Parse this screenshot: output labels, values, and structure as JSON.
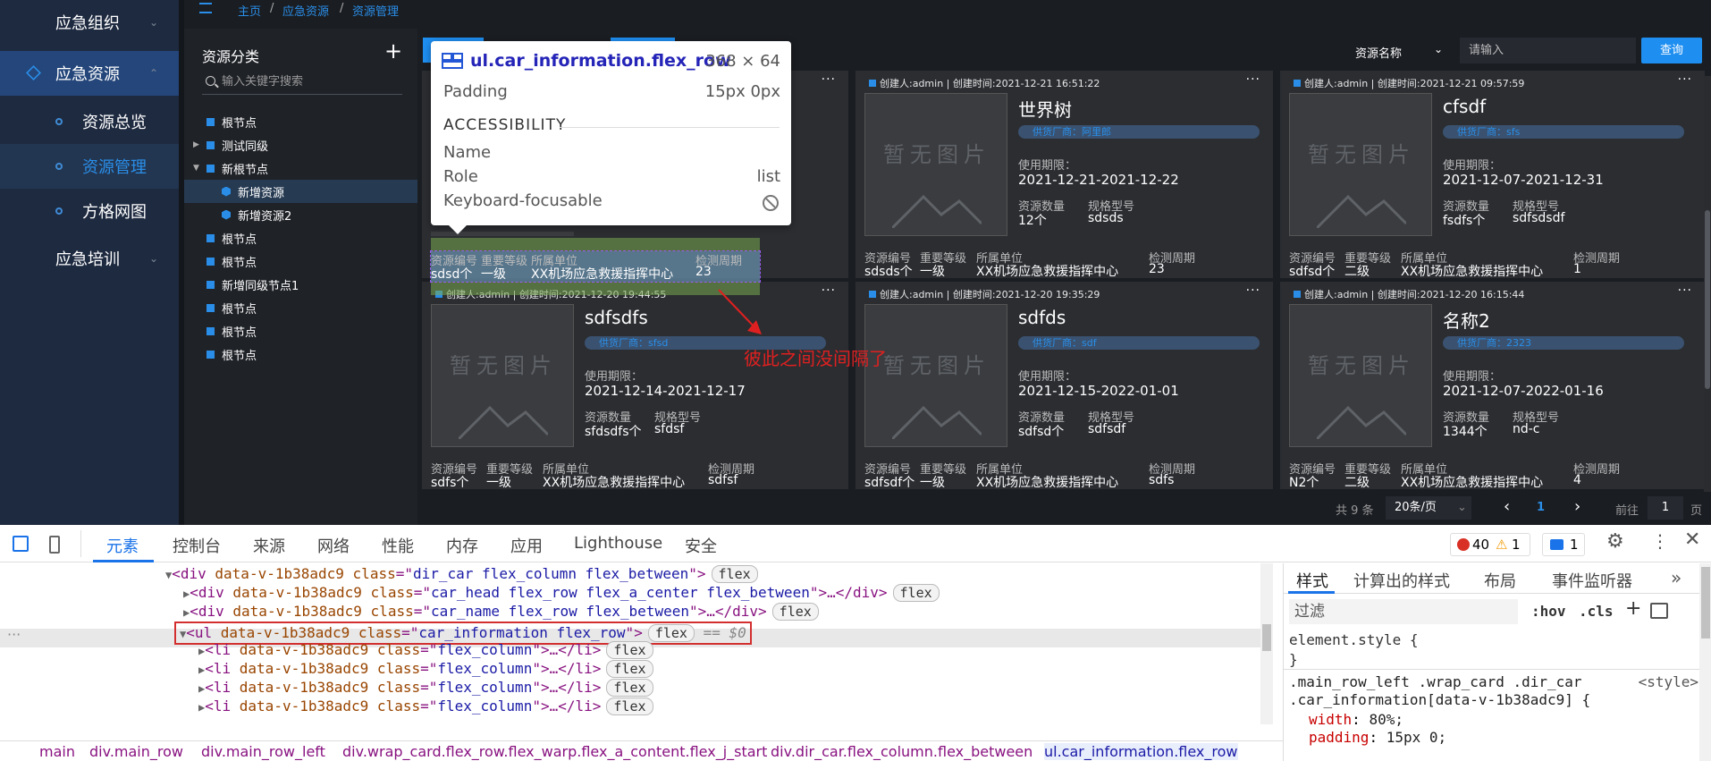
{
  "nav": {
    "items": [
      {
        "label": "应急组织",
        "chev": "⌄"
      },
      {
        "label": "应急资源",
        "chev": "⌃"
      },
      {
        "label": "资源总览"
      },
      {
        "label": "资源管理"
      },
      {
        "label": "方格网图"
      },
      {
        "label": "应急培训",
        "chev": "⌄"
      }
    ]
  },
  "breadcrumb": {
    "home": "主页",
    "sep": "/",
    "l1": "应急资源",
    "l2": "资源管理"
  },
  "tree": {
    "title": "资源分类",
    "add": "+",
    "search_placeholder": "输入关键字搜索",
    "nodes": [
      "根节点",
      "测试同级",
      "新根节点",
      "新增资源",
      "新增资源2",
      "根节点",
      "根节点",
      "新增同级节点1",
      "根节点",
      "根节点",
      "根节点"
    ]
  },
  "search": {
    "field_label": "资源名称",
    "placeholder": "请输入",
    "button": "查询"
  },
  "card_labels": {
    "vendor_prefix": "供货厂商：",
    "period": "使用期限：",
    "qty": "资源数量",
    "model": "规格型号",
    "code": "资源编号",
    "level": "重要等级",
    "unit": "所属单位",
    "cycle": "检测周期",
    "nopic": "暂无图片",
    "more": "···"
  },
  "cards": [
    {
      "header": "创建人:admin | 创建时间:2021-12-21 16:51:22",
      "name": "世界树",
      "vendor": "阿里郎",
      "date": "2021-12-21-2021-12-22",
      "qty": "12个",
      "model": "sdsds",
      "code": "sdsds个",
      "level": "一级",
      "unit": "XX机场应急救援指挥中心",
      "cycle": "23"
    },
    {
      "header": "创建人:admin | 创建时间:2021-12-21 09:57:59",
      "name": "cfsdf",
      "vendor": "sfs",
      "date": "2021-12-07-2021-12-31",
      "qty": "fsdfs个",
      "model": "sdfsdsdf",
      "code": "sdfsd个",
      "level": "二级",
      "unit": "XX机场应急救援指挥中心",
      "cycle": "1"
    },
    {
      "header": "创建人:admin | 创建时间:2021-12-20 19:44:55",
      "name": "sdfsdfs",
      "vendor": "sfsd",
      "date": "2021-12-14-2021-12-17",
      "qty": "sfdsdfs个",
      "model": "sfdsf",
      "code": "sdfs个",
      "level": "一级",
      "unit": "XX机场应急救援指挥中心",
      "cycle": "sdfsf"
    },
    {
      "header": "创建人:admin | 创建时间:2021-12-20 19:35:29",
      "name": "sdfds",
      "vendor": "sdf",
      "date": "2021-12-15-2022-01-01",
      "qty": "sdfsd个",
      "model": "sdfsdf",
      "code": "sdfsdf个",
      "level": "一级",
      "unit": "XX机场应急救援指挥中心",
      "cycle": "sdfs"
    },
    {
      "header": "创建人:admin | 创建时间:2021-12-20 16:15:44",
      "name": "名称2",
      "vendor": "2323",
      "date": "2021-12-07-2022-01-16",
      "qty": "1344个",
      "model": "nd-c",
      "code": "N2个",
      "level": "二级",
      "unit": "XX机场应急救援指挥中心",
      "cycle": "4"
    }
  ],
  "first_card_info": {
    "code": "sdsd个",
    "level": "一级",
    "unit": "XX机场应急救援指挥中心",
    "cycle": "23"
  },
  "pager": {
    "total": "共 9 条",
    "per_page": "20条/页",
    "prev": "‹",
    "page": "1",
    "next": "›",
    "goto": "前往",
    "goto_value": "1",
    "goto_suffix": "页"
  },
  "tooltip": {
    "selector": "ul.car_information.flex_row",
    "size": "368 × 64",
    "padding_label": "Padding",
    "padding_value": "15px 0px",
    "section": "ACCESSIBILITY",
    "name_label": "Name",
    "role_label": "Role",
    "role_value": "list",
    "focus_label": "Keyboard-focusable"
  },
  "annotation": "彼此之间没间隔了",
  "devtools": {
    "tabs": [
      "元素",
      "控制台",
      "来源",
      "网络",
      "性能",
      "内存",
      "应用",
      "Lighthouse",
      "安全"
    ],
    "errors": "40",
    "warnings": "1",
    "messages": "1",
    "code": [
      {
        "tag": "<div",
        "attr": "data-v-1b38adc9",
        "cls": "dir_car flex_column flex_between",
        "end": ">",
        "pill": "flex"
      },
      {
        "tag": "<div",
        "attr": "data-v-1b38adc9",
        "cls": "car_head flex_row flex_a_center flex_between",
        "end": ">…</div>",
        "pill": "flex"
      },
      {
        "tag": "<div",
        "attr": "data-v-1b38adc9",
        "cls": "car_name flex_row flex_between",
        "end": ">…</div>",
        "pill": "flex"
      },
      {
        "tag": "<ul",
        "attr": "data-v-1b38adc9",
        "cls": "car_information flex_row",
        "end": ">",
        "pill": "flex",
        "eq": "== $0"
      },
      {
        "tag": "<li",
        "attr": "data-v-1b38adc9",
        "cls": "flex_column",
        "end": ">…</li>",
        "pill": "flex"
      },
      {
        "tag": "<li",
        "attr": "data-v-1b38adc9",
        "cls": "flex_column",
        "end": ">…</li>",
        "pill": "flex"
      },
      {
        "tag": "<li",
        "attr": "data-v-1b38adc9",
        "cls": "flex_column",
        "end": ">…</li>",
        "pill": "flex"
      },
      {
        "tag": "<li",
        "attr": "data-v-1b38adc9",
        "cls": "flex_column",
        "end": ">…</li>",
        "pill": "flex"
      }
    ],
    "styles_tabs": [
      "样式",
      "计算出的样式",
      "布局",
      "事件监听器"
    ],
    "filter": "过滤",
    "hov": ":hov",
    "cls": ".cls",
    "element_style": "element.style {",
    "close_brace": "}",
    "rule_selector1": ".main_row_left .wrap_card .dir_car",
    "rule_selector2": ".car_information[data-v-1b38adc9] {",
    "rule_source": "<style>",
    "prop_width": "width",
    "prop_width_val": "80%;",
    "prop_padding": "padding",
    "prop_padding_val": "15px 0;",
    "breadcrumbs": [
      "main",
      "div.main_row",
      "div.main_row_left",
      "div.wrap_card.flex_row.flex_warp.flex_a_content.flex_j_start",
      "div.dir_car.flex_column.flex_between",
      "ul.car_information.flex_row"
    ]
  }
}
